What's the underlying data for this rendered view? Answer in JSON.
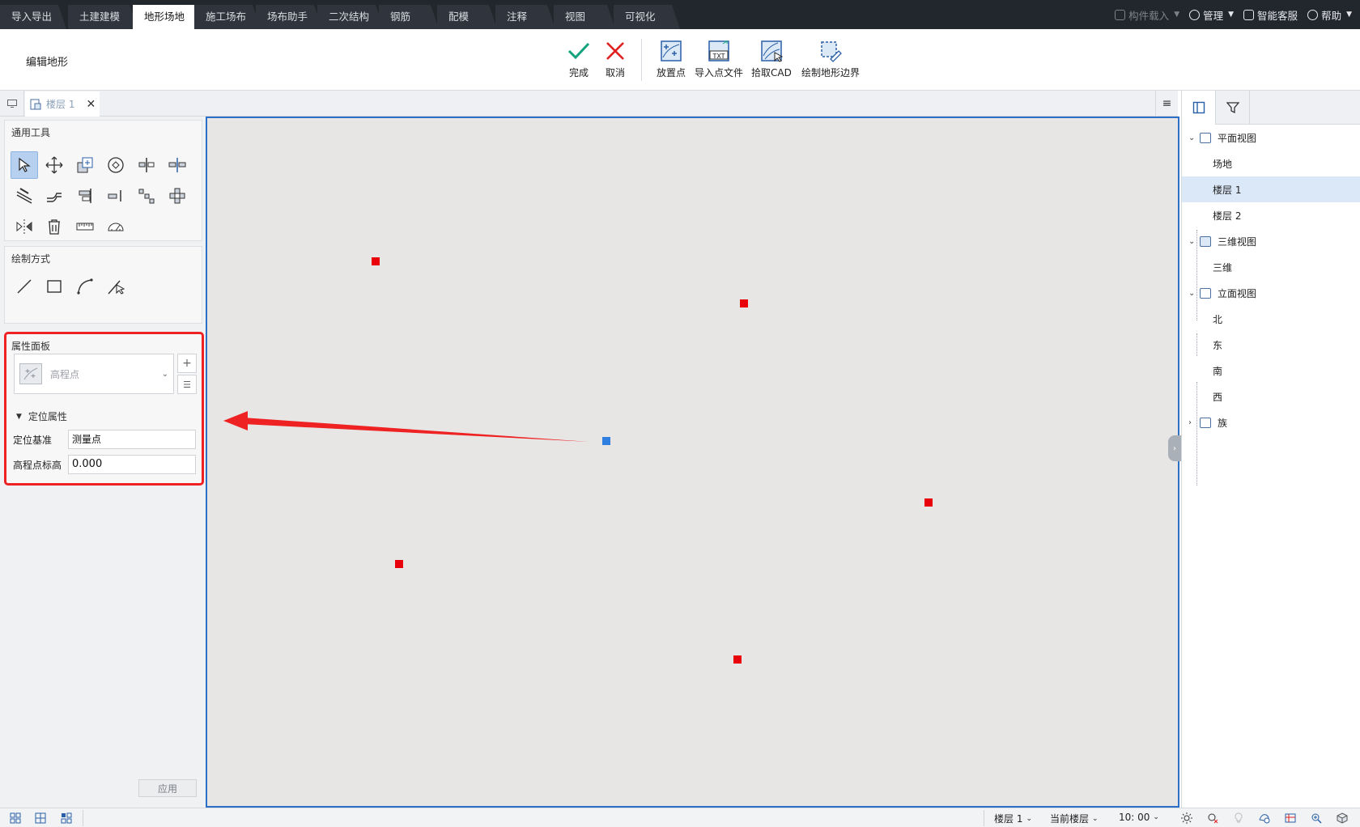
{
  "menubar": {
    "tabs": [
      "导入导出",
      "土建建模",
      "地形场地",
      "施工场布",
      "场布助手",
      "二次结构",
      "钢筋",
      "配模",
      "注释",
      "视图",
      "可视化"
    ],
    "active_tab": "地形场地",
    "right": {
      "component_load": "构件载入",
      "manage": "管理",
      "service": "智能客服",
      "help": "帮助"
    }
  },
  "ribbon": {
    "title": "编辑地形",
    "finish": "完成",
    "cancel": "取消",
    "place_point": "放置点",
    "import_point_file": "导入点文件",
    "pick_cad": "拾取CAD",
    "draw_boundary": "绘制地形边界",
    "txt_label": "TXT"
  },
  "doc_tabs": {
    "active": "楼层 1"
  },
  "left_panel": {
    "general_tools_title": "通用工具",
    "draw_mode_title": "绘制方式",
    "properties": {
      "title": "属性面板",
      "type_name": "高程点",
      "group": "定位属性",
      "fields": [
        {
          "label": "定位基准",
          "value": "测量点"
        },
        {
          "label": "高程点标高",
          "value": "0.000"
        }
      ],
      "apply": "应用"
    }
  },
  "canvas": {
    "points_count_shown": 6,
    "selected_point": "blue",
    "colors": {
      "point": "#e8000b",
      "selected": "#2f7fe0",
      "arrow": "#ee2222",
      "border": "#2b6fc7"
    }
  },
  "right_panel": {
    "tree": [
      {
        "label": "平面视图",
        "level": 0,
        "expanded": true
      },
      {
        "label": "场地",
        "level": 1
      },
      {
        "label": "楼层 1",
        "level": 1,
        "selected": true
      },
      {
        "label": "楼层 2",
        "level": 1
      },
      {
        "label": "三维视图",
        "level": 0,
        "expanded": true
      },
      {
        "label": "三维",
        "level": 1
      },
      {
        "label": "立面视图",
        "level": 0,
        "expanded": true
      },
      {
        "label": "北",
        "level": 1
      },
      {
        "label": "东",
        "level": 1
      },
      {
        "label": "南",
        "level": 1
      },
      {
        "label": "西",
        "level": 1
      },
      {
        "label": "族",
        "level": 0,
        "expanded": false
      }
    ]
  },
  "statusbar": {
    "floor": "楼层 1",
    "scope": "当前楼层",
    "scale": "10: 00"
  }
}
